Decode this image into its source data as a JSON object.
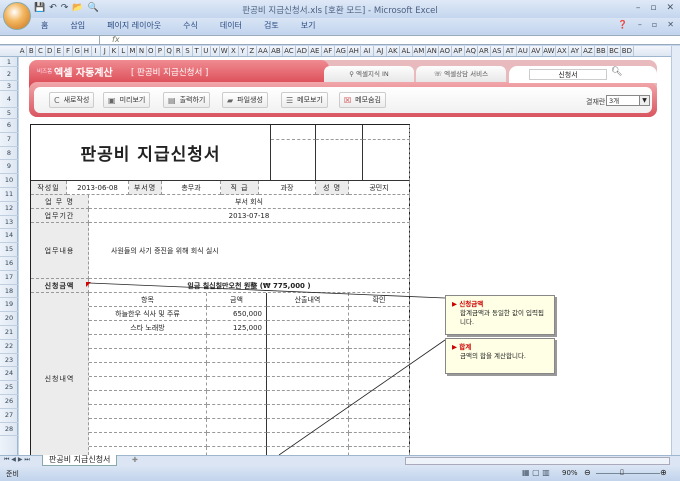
{
  "window": {
    "title": "판공비 지급신청서.xls  [호환 모드]  - Microsoft Excel"
  },
  "ribbon": {
    "tabs": [
      "홈",
      "삽입",
      "페이지 레이아웃",
      "수식",
      "데이터",
      "검토",
      "보기"
    ]
  },
  "formula_bar": {
    "fx": "fx",
    "name_box": ""
  },
  "columns": [
    "A",
    "B",
    "C",
    "D",
    "E",
    "F",
    "G",
    "H",
    "I",
    "J",
    "K",
    "L",
    "M",
    "N",
    "O",
    "P",
    "Q",
    "R",
    "S",
    "T",
    "U",
    "V",
    "W",
    "X",
    "Y",
    "Z",
    "AA",
    "AB",
    "AC",
    "AD",
    "AE",
    "AF",
    "AG",
    "AH",
    "AI",
    "AJ",
    "AK",
    "AL",
    "AM",
    "AN",
    "AO",
    "AP",
    "AQ",
    "AR",
    "AS",
    "AT",
    "AU",
    "AV",
    "AW",
    "AX",
    "AY",
    "AZ",
    "BB",
    "BC",
    "BD"
  ],
  "rows": [
    "1",
    "2",
    "3",
    "4",
    "5",
    "6",
    "7",
    "8",
    "9",
    "10",
    "11",
    "12",
    "13",
    "14",
    "15",
    "16",
    "17",
    "18",
    "19",
    "20",
    "21",
    "22",
    "23",
    "24",
    "25",
    "26",
    "27",
    "28"
  ],
  "banner": {
    "brand_small": "비즈폼",
    "brand": "엑셀 자동계산",
    "subtitle": "[ 판공비 지급신청서 ]",
    "tab1": "엑셀지식 IN",
    "tab2": "엑셀상담 서비스",
    "search_value": "신청서",
    "buttons": [
      "새로작성",
      "미리보기",
      "출력하기",
      "파일생성",
      "메모보기",
      "메모숨김"
    ],
    "approval_label": "결재란",
    "approval_value": "3개"
  },
  "form": {
    "title": "판공비 지급신청서",
    "date_label": "작성일",
    "date": "2013-06-08",
    "dept_label": "부서명",
    "dept": "총무과",
    "rank_label": "직 급",
    "rank": "과장",
    "name_label": "성 명",
    "name": "공민지",
    "task_label": "업 무 명",
    "task": "부서 회식",
    "period_label": "업무기간",
    "period": "2013-07-18",
    "content_label": "업무내용",
    "content": "사원들의 사기 증진을 위해 회식 실시",
    "amount_label": "신청금액",
    "amount_text": "일금   칠십칠만오천   원整   (₩   775,000  )",
    "detail_label": "신청내역",
    "headers": [
      "항목",
      "금액",
      "산출내역",
      "확인"
    ],
    "items": [
      {
        "name": "하늘한우 식사 및 주류",
        "amount": "650,000"
      },
      {
        "name": "스타 노래방",
        "amount": "125,000"
      }
    ]
  },
  "comments": [
    {
      "title": "신청금액",
      "body": "합계금액과 동일한 값이 입력됩니다."
    },
    {
      "title": "합계",
      "body": "금액의 합을 계산합니다."
    }
  ],
  "sheet_tab": "판공비 지급신청서",
  "status": {
    "ready": "준비",
    "zoom": "90%"
  }
}
